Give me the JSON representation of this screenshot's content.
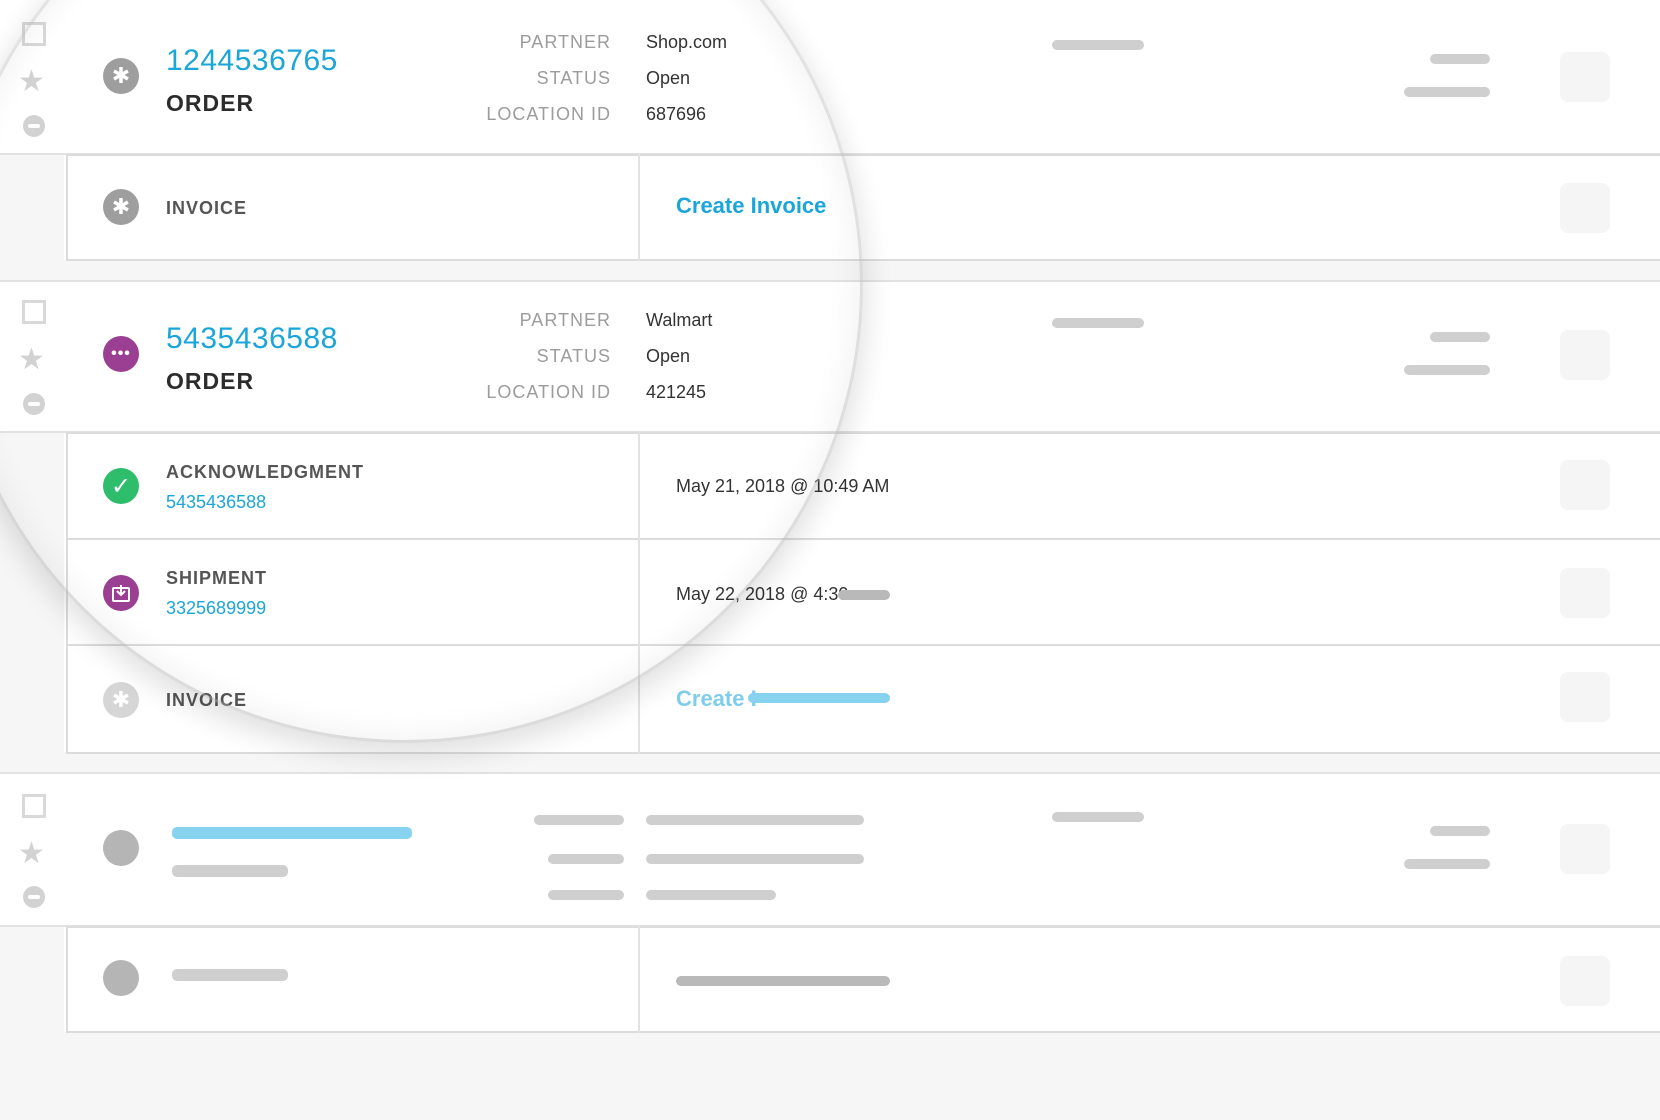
{
  "orders": [
    {
      "order_number": "1244536765",
      "order_label": "ORDER",
      "meta": [
        {
          "key": "PARTNER",
          "value": "Shop.com"
        },
        {
          "key": "STATUS",
          "value": "Open"
        },
        {
          "key": "LOCATION ID",
          "value": "687696"
        }
      ],
      "docs": [
        {
          "label": "INVOICE",
          "action": "Create Invoice"
        }
      ]
    },
    {
      "order_number": "5435436588",
      "order_label": "ORDER",
      "meta": [
        {
          "key": "PARTNER",
          "value": "Walmart"
        },
        {
          "key": "STATUS",
          "value": "Open"
        },
        {
          "key": "LOCATION ID",
          "value": "421245"
        }
      ],
      "docs": [
        {
          "label": "ACKNOWLEDGMENT",
          "link": "5435436588",
          "date": "May 21, 2018 @ 10:49 AM"
        },
        {
          "label": "SHIPMENT",
          "link": "3325689999",
          "date": "May 22, 2018 @ 4:30"
        },
        {
          "label": "INVOICE",
          "action": "Create I"
        }
      ]
    }
  ],
  "icons": {
    "row1": "asterisk-icon",
    "row2": "more-dots-icon",
    "ack": "check-icon",
    "shipment": "download-box-icon",
    "checkbox": "checkbox-icon",
    "star": "star-icon",
    "remove": "minus-circle-icon"
  },
  "colors": {
    "link": "#1ba6da",
    "green": "#2ebd6b",
    "purple": "#9b3f92",
    "grey_icon": "#9e9e9e"
  }
}
